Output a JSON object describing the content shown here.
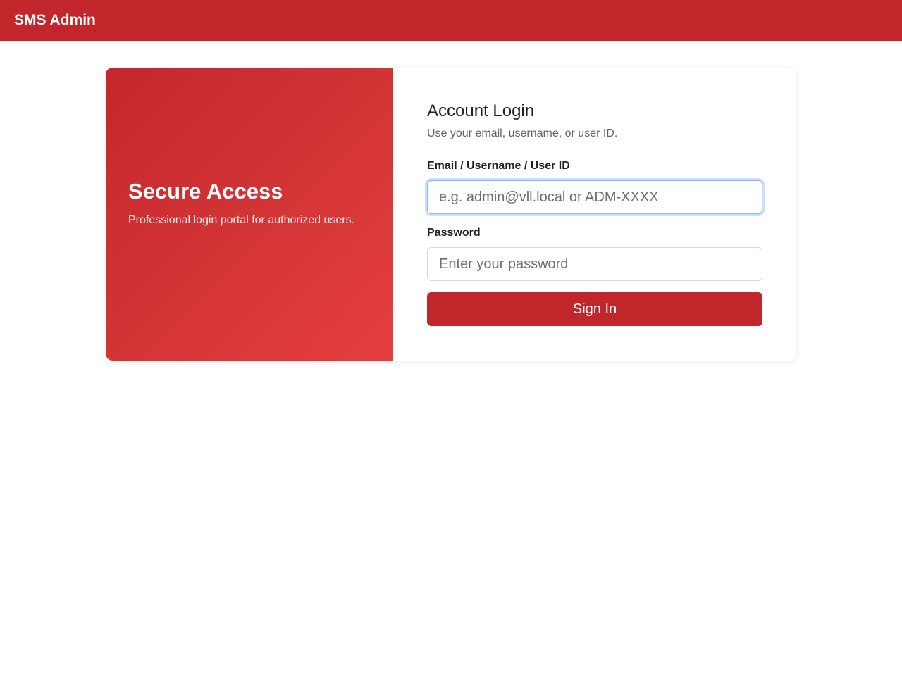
{
  "header": {
    "brand": "SMS Admin"
  },
  "hero": {
    "title": "Secure Access",
    "subtitle": "Professional login portal for authorized users."
  },
  "login": {
    "title": "Account Login",
    "subtitle": "Use your email, username, or user ID.",
    "identifier": {
      "label": "Email / Username / User ID",
      "placeholder": "e.g. admin@vll.local or ADM-XXXX",
      "value": ""
    },
    "password": {
      "label": "Password",
      "placeholder": "Enter your password",
      "value": ""
    },
    "submit_label": "Sign In"
  },
  "colors": {
    "brand_red": "#c1272a",
    "hero_gradient_start": "#c4262b",
    "hero_gradient_end": "#e53e3e",
    "focus_ring": "#86b7fe"
  }
}
